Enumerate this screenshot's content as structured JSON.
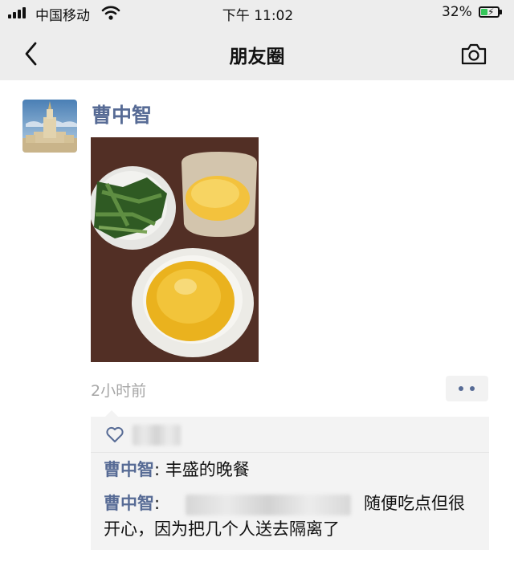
{
  "status_bar": {
    "carrier": "中国移动",
    "time": "下午 11:02",
    "battery": "32%"
  },
  "nav": {
    "title": "朋友圈"
  },
  "post": {
    "author": "曹中智",
    "time_ago": "2小时前",
    "comments": [
      {
        "name": "曹中智",
        "sep": ":",
        "text": " 丰盛的晚餐"
      },
      {
        "name": "曹中智",
        "sep": ":",
        "text_after_redacted": "随便吃点但很",
        "text_line2": "开心，因为把几个人送去隔离了"
      }
    ]
  },
  "colors": {
    "link": "#576b95",
    "bar_bg": "#ededed",
    "comment_bg": "#f3f3f3"
  }
}
